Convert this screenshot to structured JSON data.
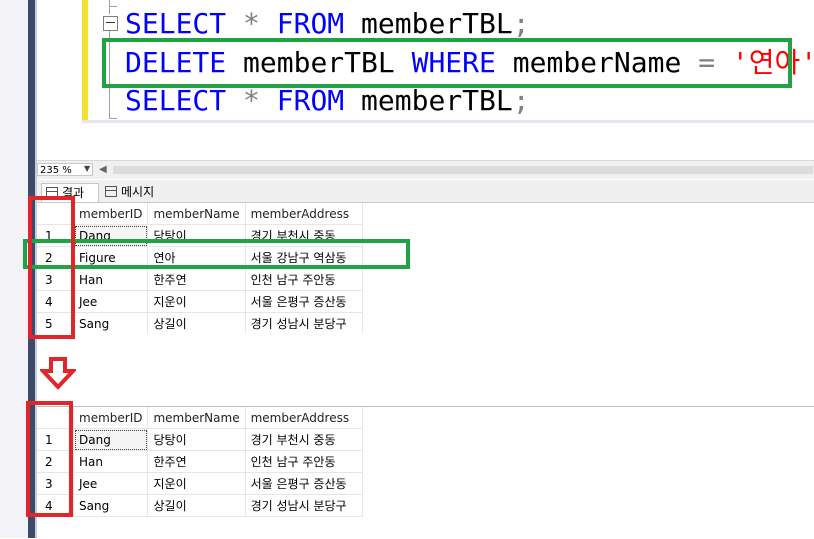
{
  "editor": {
    "lines": [
      {
        "kw1": "SELECT",
        "op": "*",
        "kw2": "FROM",
        "ident": "memberTBL",
        "end": ";"
      },
      {
        "kw1": "DELETE",
        "ident": "memberTBL",
        "kw2": "WHERE",
        "col": "memberName",
        "op": "=",
        "str": "'연아'",
        "end": ";"
      },
      {
        "kw1": "SELECT",
        "op": "*",
        "kw2": "FROM",
        "ident": "memberTBL",
        "end": ";"
      }
    ]
  },
  "zoom": {
    "value": "235 %"
  },
  "tabs": {
    "results": "결과",
    "messages": "메시지"
  },
  "grid_before": {
    "headers": [
      "memberID",
      "memberName",
      "memberAddress"
    ],
    "rows": [
      {
        "n": "1",
        "id": "Dang",
        "name": "당탕이",
        "addr": "경기 부천시 중동"
      },
      {
        "n": "2",
        "id": "Figure",
        "name": "연아",
        "addr": "서울 강남구 역삼동"
      },
      {
        "n": "3",
        "id": "Han",
        "name": "한주연",
        "addr": "인천 남구 주안동"
      },
      {
        "n": "4",
        "id": "Jee",
        "name": "지운이",
        "addr": "서울 은평구 증산동"
      },
      {
        "n": "5",
        "id": "Sang",
        "name": "상길이",
        "addr": "경기 성남시 분당구"
      }
    ]
  },
  "grid_after": {
    "headers": [
      "memberID",
      "memberName",
      "memberAddress"
    ],
    "rows": [
      {
        "n": "1",
        "id": "Dang",
        "name": "당탕이",
        "addr": "경기 부천시 중동"
      },
      {
        "n": "2",
        "id": "Han",
        "name": "한주연",
        "addr": "인천 남구 주안동"
      },
      {
        "n": "3",
        "id": "Jee",
        "name": "지운이",
        "addr": "서울 은평구 증산동"
      },
      {
        "n": "4",
        "id": "Sang",
        "name": "상길이",
        "addr": "경기 성남시 분당구"
      }
    ]
  },
  "colors": {
    "highlight_green": "#21a345",
    "highlight_red": "#e2252b",
    "keyword": "#0000ff",
    "string": "#ff0000"
  },
  "icons": {
    "arrow": "down-arrow-icon"
  }
}
